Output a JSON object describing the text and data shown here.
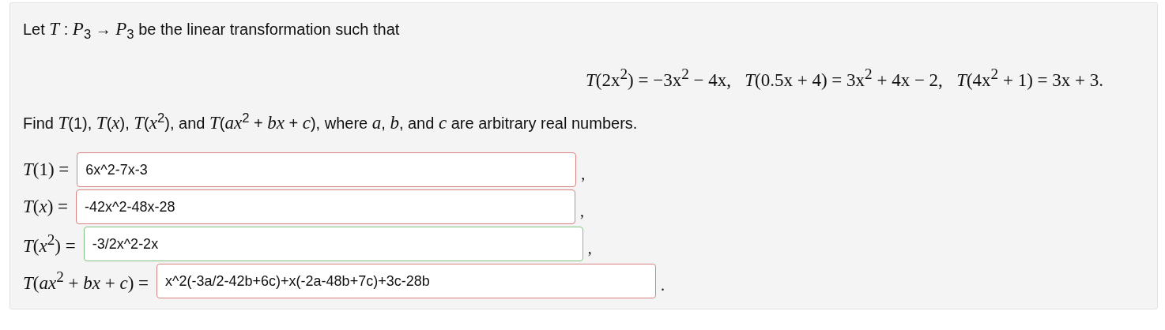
{
  "intro": "Let *T* : *P*$_{3}$ → *P*$_{3}$ be the linear transformation such that",
  "equation": "*T*(2x$^{2}$) = −3x$^{2}$ − 4x,   *T*(0.5x + 4) = 3x$^{2}$ + 4x − 2,   *T*(4x$^{2}$ + 1) = 3x + 3.",
  "question": "Find *T*(1), *T*(*x*), *T*(*x*$^{2}$), and *T*(*ax*$^{2}$ + *bx* + *c*), where *a*, *b*, and *c* are arbitrary real numbers.",
  "answers": [
    {
      "label": "*T*(1) =",
      "value": "6x^2-7x-3",
      "color": "#d98080",
      "punctuation": ","
    },
    {
      "label": "*T*(*x*) =",
      "value": "-42x^2-48x-28",
      "color": "#d98080",
      "punctuation": ","
    },
    {
      "label": "*T*(*x*$^{2}$) =",
      "value": "-3/2x^2-2x",
      "color": "#7fbf7f",
      "punctuation": ","
    },
    {
      "label": "*T*(*ax*$^{2}$ + *bx* + *c*) =",
      "value": "x^2(-3a/2-42b+6c)+x(-2a-48b+7c)+3c-28b",
      "color": "#d98080",
      "punctuation": "."
    }
  ]
}
